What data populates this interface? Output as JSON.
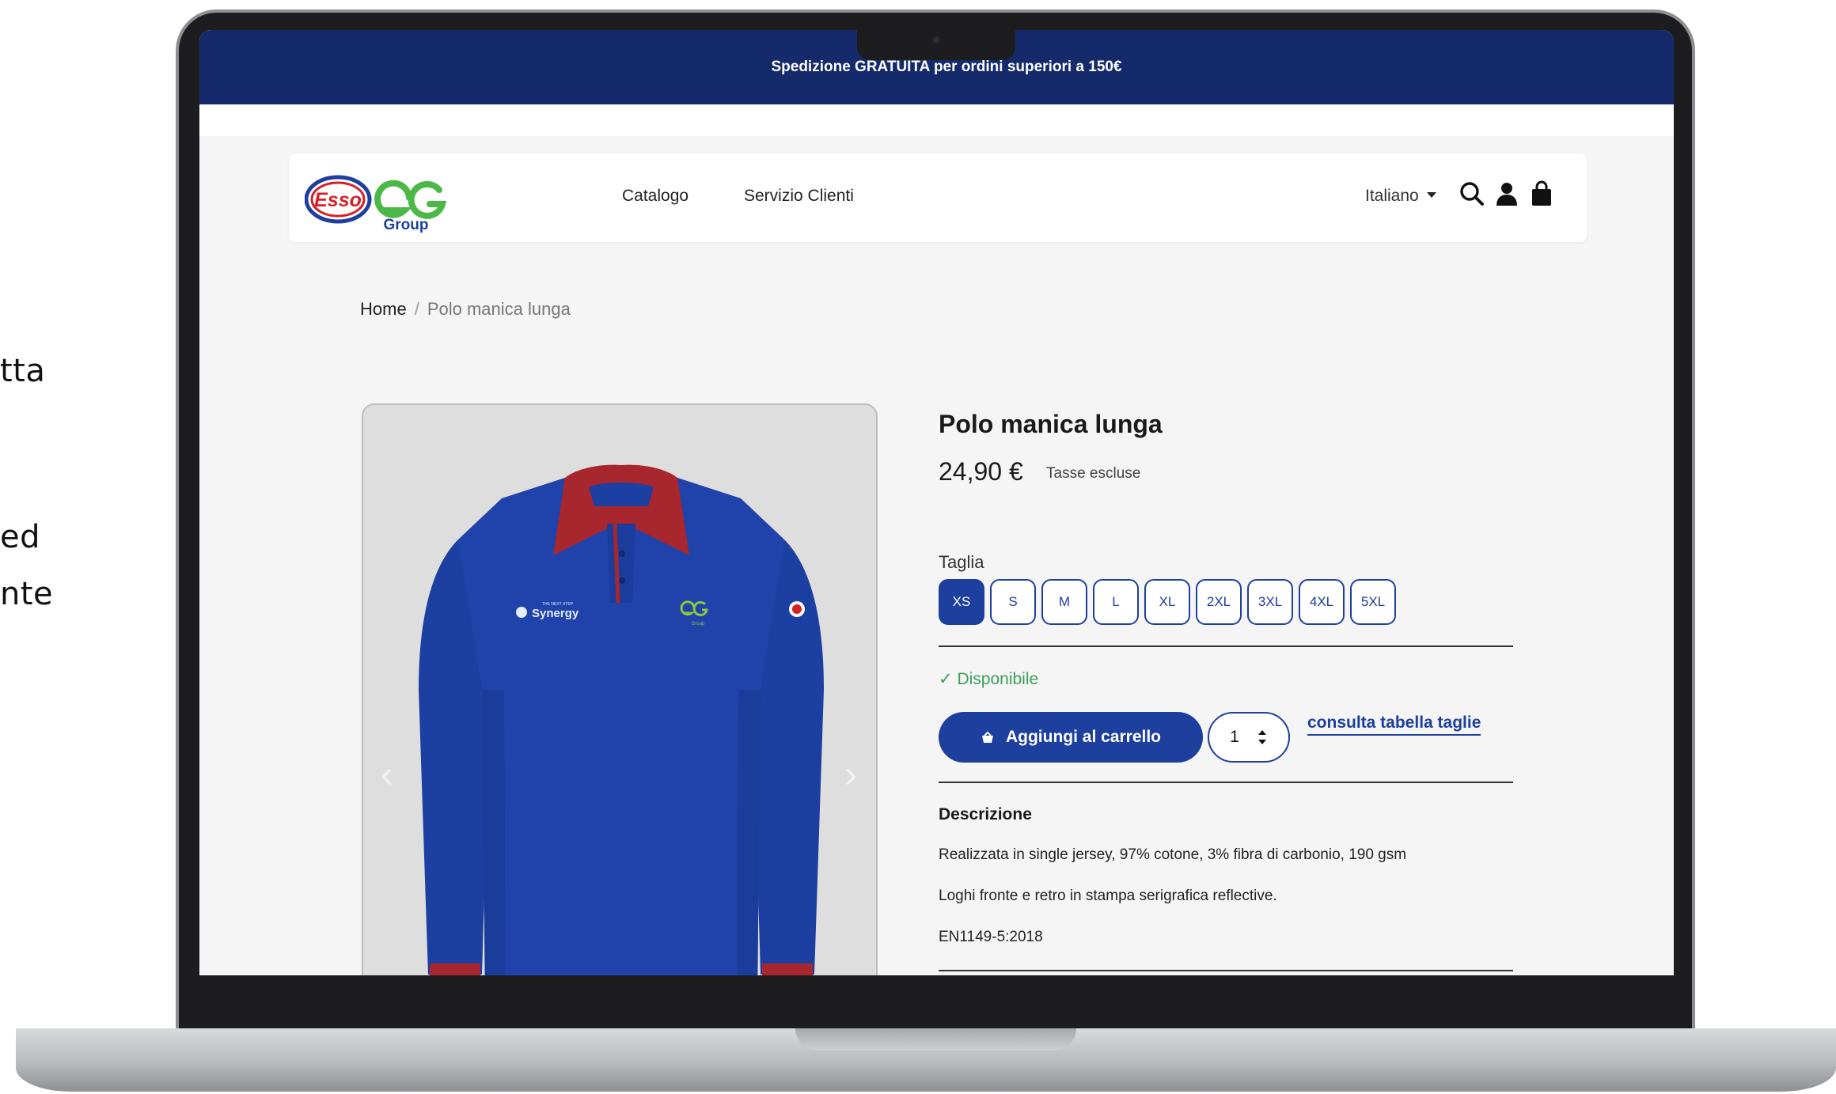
{
  "side_text": [
    "tta",
    "ed",
    "nte"
  ],
  "promo": {
    "text": "Spedizione GRATUITA per ordini superiori a 150€"
  },
  "header": {
    "logo_esso": "Esso",
    "logo_group": "Group",
    "nav": [
      "Catalogo",
      "Servizio Clienti"
    ],
    "language": "Italiano",
    "icons": [
      "search-icon",
      "user-icon",
      "bag-icon"
    ]
  },
  "breadcrumb": {
    "home": "Home",
    "separator": "/",
    "current": "Polo manica lunga"
  },
  "gallery": {
    "prev": "‹",
    "next": "›",
    "chest_logo": "Synergy",
    "chest_logo_small": "THE NEXT STEP",
    "eg_small": "Group"
  },
  "product": {
    "title": "Polo manica lunga",
    "price": "24,90 €",
    "price_note": "Tasse escluse",
    "size_label": "Taglia",
    "sizes": [
      "XS",
      "S",
      "M",
      "L",
      "XL",
      "2XL",
      "3XL",
      "4XL",
      "5XL"
    ],
    "selected_size": "XS",
    "availability": "Disponibile",
    "add_to_cart": "Aggiungi al carrello",
    "quantity": "1",
    "size_chart_link": "consulta tabella taglie",
    "description_title": "Descrizione",
    "description": [
      "Realizzata in single jersey, 97% cotone, 3% fibra di carbonio, 190 gsm",
      "Loghi fronte e retro in stampa serigrafica reflective.",
      "EN1149-5:2018"
    ]
  },
  "colors": {
    "brand_blue": "#1d3f9e",
    "promo_bg": "#142a6b",
    "available_green": "#3aa05a",
    "collar_red": "#a8262d",
    "polo_blue": "#1c3fa2"
  }
}
